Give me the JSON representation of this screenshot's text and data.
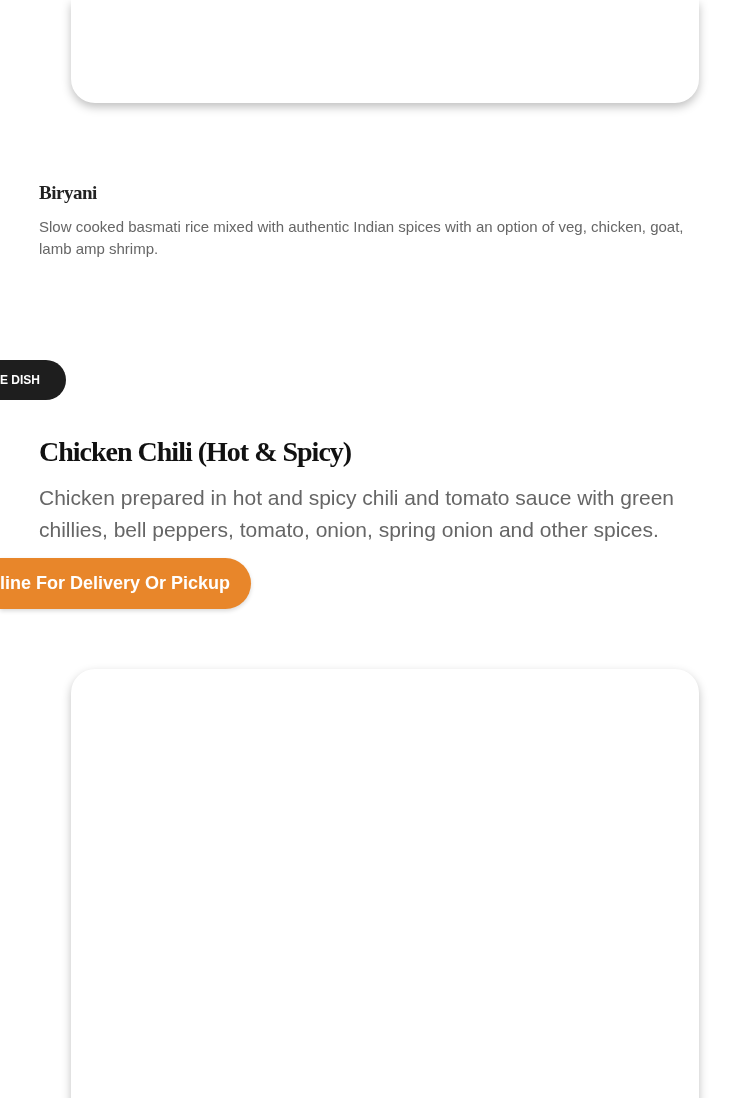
{
  "dishes": [
    {
      "kind": "small",
      "title": "Biryani",
      "description": "Slow cooked basmati rice mixed with authentic Indian spices with an option of veg, chicken, goat, lamb amp shrimp."
    },
    {
      "kind": "featured",
      "badge": "E DISH",
      "title": "Chicken Chili (Hot & Spicy)",
      "description": "Chicken prepared in hot and spicy chili and tomato sauce with green chillies, bell peppers, tomato, onion, spring onion and other spices.",
      "button": "line For Delivery Or Pickup"
    }
  ]
}
